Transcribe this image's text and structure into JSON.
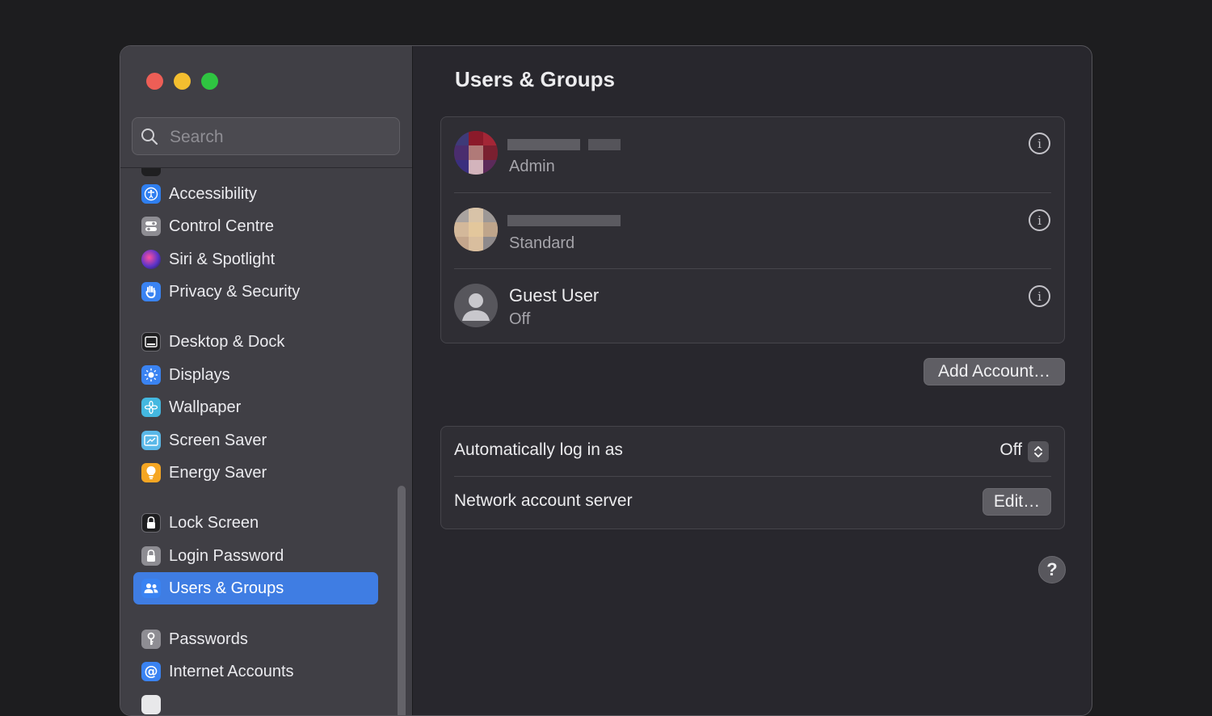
{
  "window": {
    "title": "Users & Groups"
  },
  "search": {
    "placeholder": "Search"
  },
  "sidebar": {
    "items": [
      {
        "label": "Accessibility",
        "icon": "accessibility-icon",
        "color": "#2f7ff0"
      },
      {
        "label": "Control Centre",
        "icon": "control-centre-icon",
        "color": "#8e8d93"
      },
      {
        "label": "Siri & Spotlight",
        "icon": "siri-icon",
        "color": "#9a3fd6"
      },
      {
        "label": "Privacy & Security",
        "icon": "hand-icon",
        "color": "#3a83f2"
      },
      {
        "label": "Desktop & Dock",
        "icon": "dock-icon",
        "color": "#1f1f21"
      },
      {
        "label": "Displays",
        "icon": "sun-icon",
        "color": "#3a83f2"
      },
      {
        "label": "Wallpaper",
        "icon": "flower-icon",
        "color": "#44b8e0"
      },
      {
        "label": "Screen Saver",
        "icon": "screen-saver-icon",
        "color": "#5ab8e8"
      },
      {
        "label": "Energy Saver",
        "icon": "lightbulb-icon",
        "color": "#f5a623"
      },
      {
        "label": "Lock Screen",
        "icon": "lock-icon",
        "color": "#1f1f21"
      },
      {
        "label": "Login Password",
        "icon": "padlock-icon",
        "color": "#8e8d93"
      },
      {
        "label": "Users & Groups",
        "icon": "users-icon",
        "color": "#3a83f2",
        "selected": true
      },
      {
        "label": "Passwords",
        "icon": "key-icon",
        "color": "#8e8d93"
      },
      {
        "label": "Internet Accounts",
        "icon": "at-icon",
        "color": "#3a83f2"
      }
    ]
  },
  "users": [
    {
      "name": "",
      "role": "Admin"
    },
    {
      "name": "",
      "role": "Standard"
    },
    {
      "name": "Guest User",
      "role": "Off"
    }
  ],
  "buttons": {
    "add_account": "Add Account…",
    "edit": "Edit…",
    "help": "?"
  },
  "settings": {
    "auto_login_label": "Automatically log in as",
    "auto_login_value": "Off",
    "network_server_label": "Network account server"
  }
}
